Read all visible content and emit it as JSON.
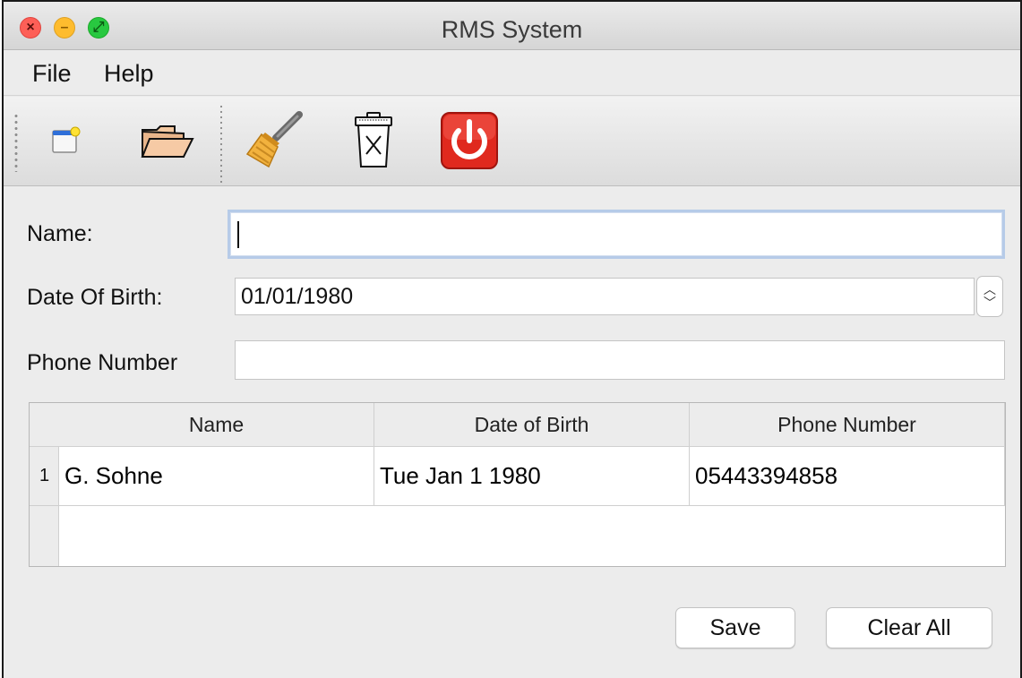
{
  "window": {
    "title": "RMS System",
    "controls": [
      "close",
      "minimize",
      "maximize"
    ]
  },
  "menubar": {
    "items": [
      {
        "label": "File"
      },
      {
        "label": "Help"
      }
    ]
  },
  "toolbar": {
    "buttons": [
      {
        "icon": "new-document-icon"
      },
      {
        "icon": "open-folder-icon"
      },
      {
        "icon": "broom-icon"
      },
      {
        "icon": "trash-icon"
      },
      {
        "icon": "power-icon"
      }
    ]
  },
  "form": {
    "name_label": "Name:",
    "name_value": "",
    "dob_label": "Date Of Birth:",
    "dob_value": "01/01/1980",
    "phone_label": "Phone Number",
    "phone_value": ""
  },
  "table": {
    "columns": [
      "Name",
      "Date of Birth",
      "Phone Number"
    ],
    "rows": [
      {
        "num": "1",
        "name": "G. Sohne",
        "dob": "Tue Jan 1 1980",
        "phone": "05443394858"
      }
    ]
  },
  "buttons": {
    "save_label": "Save",
    "clear_label": "Clear All"
  },
  "colors": {
    "close": "#fd5f57",
    "minimize": "#febc2e",
    "maximize": "#28c840",
    "focus_ring": "#b6cbe8",
    "power_red": "#e0291e"
  }
}
